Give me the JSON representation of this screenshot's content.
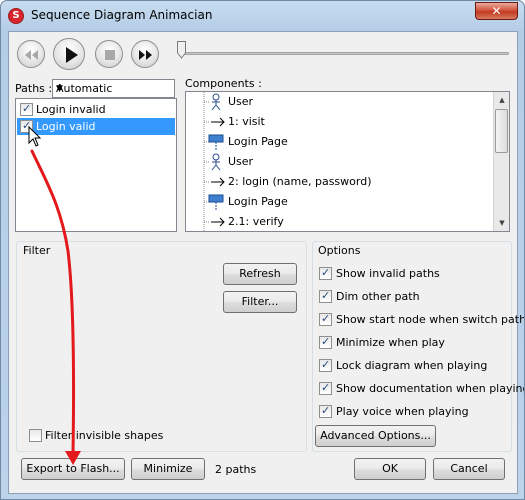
{
  "window": {
    "title": "Sequence Diagram Animacian",
    "close_glyph": "✕"
  },
  "toolbar": {
    "buttons": [
      "rewind-icon",
      "play-icon",
      "stop-icon",
      "fast-forward-icon"
    ],
    "slider_position": 0
  },
  "paths": {
    "label": "Paths :",
    "selected_option": "Automatic",
    "items": [
      {
        "label": "Login invalid",
        "checked": true,
        "selected": false
      },
      {
        "label": "Login valid",
        "checked": true,
        "selected": true
      }
    ]
  },
  "components": {
    "label": "Components :",
    "rows": [
      {
        "type": "actor",
        "text": "User"
      },
      {
        "type": "message",
        "text": "1: visit"
      },
      {
        "type": "lifeline",
        "text": "Login Page"
      },
      {
        "type": "actor",
        "text": "User"
      },
      {
        "type": "message",
        "text": "2: login (name, password)"
      },
      {
        "type": "lifeline",
        "text": "Login Page"
      },
      {
        "type": "message",
        "text": "2.1: verify"
      }
    ]
  },
  "filter": {
    "title": "Filter",
    "refresh_label": "Refresh",
    "filter_label": "Filter...",
    "invisible_label": "Filter invisible shapes",
    "invisible_checked": false
  },
  "options": {
    "title": "Options",
    "items": [
      {
        "label": "Show invalid paths",
        "checked": true
      },
      {
        "label": "Dim other path",
        "checked": true
      },
      {
        "label": "Show start node when switch path",
        "checked": true
      },
      {
        "label": "Minimize when play",
        "checked": true
      },
      {
        "label": "Lock diagram when playing",
        "checked": true
      },
      {
        "label": "Show documentation when playing",
        "checked": true
      },
      {
        "label": "Play voice when playing",
        "checked": true
      }
    ],
    "advanced_label": "Advanced Options..."
  },
  "footer": {
    "export_label": "Export to Flash...",
    "minimize_label": "Minimize",
    "status": "2 paths",
    "ok_label": "OK",
    "cancel_label": "Cancel"
  },
  "colors": {
    "selection": "#3399ff",
    "annotation_arrow": "#e3191b"
  }
}
